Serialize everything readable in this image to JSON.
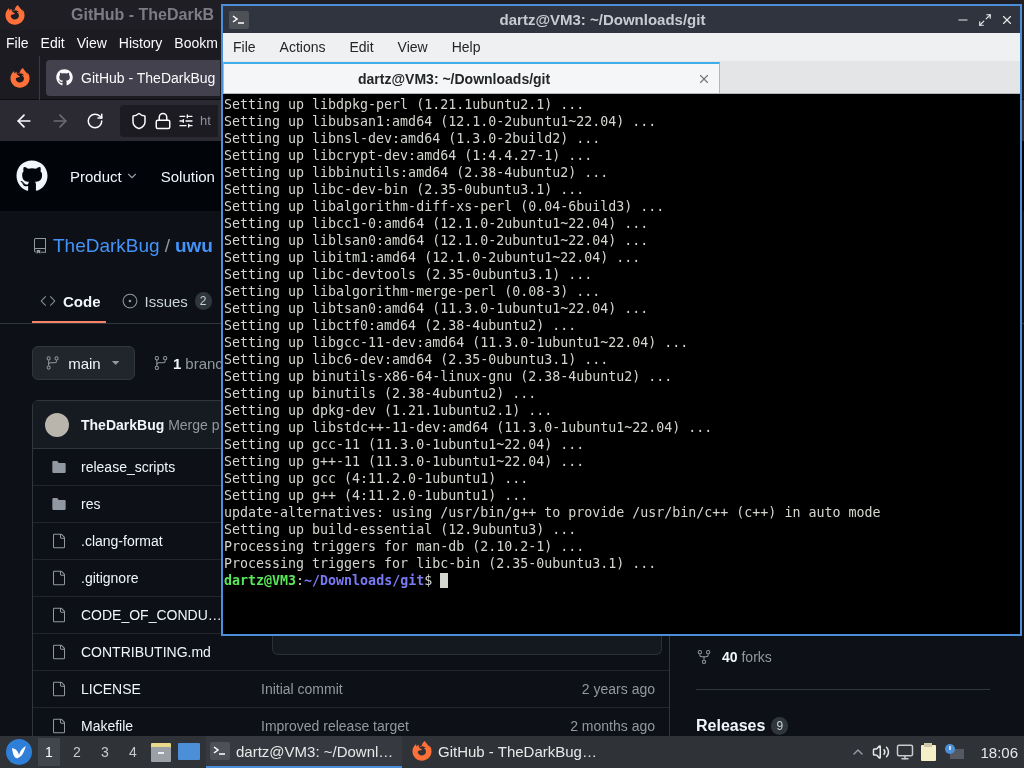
{
  "browser": {
    "window_title": "GitHub - TheDarkB",
    "menu": [
      "File",
      "Edit",
      "View",
      "History",
      "Bookm"
    ],
    "tab": {
      "title": "GitHub - TheDarkBug"
    },
    "nav_buttons": [
      {
        "kind": "back",
        "disabled": false
      },
      {
        "kind": "forward",
        "disabled": true
      },
      {
        "kind": "reload",
        "disabled": false
      }
    ],
    "url_prefix": "ht",
    "github": {
      "nav": [
        {
          "label": "Product",
          "dropdown": true
        },
        {
          "label": "Solution",
          "dropdown": false
        }
      ],
      "owner": "TheDarkBug",
      "separator": "/",
      "repo": "uwu",
      "repo_tabs": [
        {
          "kind": "code",
          "label": "Code",
          "selected": true
        },
        {
          "kind": "issues",
          "label": "Issues",
          "count": "2",
          "selected": false
        }
      ],
      "branch": "main",
      "branches_count": "1",
      "branches_label": "branc",
      "latest_commit": {
        "author": "TheDarkBug",
        "message": "Merge p"
      },
      "files": [
        {
          "kind": "folder",
          "name": "release_scripts"
        },
        {
          "kind": "folder",
          "name": "res"
        },
        {
          "kind": "file",
          "name": ".clang-format"
        },
        {
          "kind": "file",
          "name": ".gitignore"
        },
        {
          "kind": "file",
          "name": "CODE_OF_CONDU…"
        },
        {
          "kind": "file",
          "name": "CONTRIBUTING.md"
        },
        {
          "kind": "file",
          "name": "LICENSE",
          "message": "Initial commit",
          "time": "2 years ago"
        },
        {
          "kind": "file",
          "name": "Makefile",
          "message": "Improved release target",
          "time": "2 months ago"
        }
      ],
      "sidebar": {
        "forks_count": "40",
        "forks_label": "forks",
        "releases_label": "Releases",
        "releases_count": "9"
      }
    }
  },
  "terminal": {
    "title": "dartz@VM3: ~/Downloads/git",
    "menu": [
      "File",
      "Actions",
      "Edit",
      "View",
      "Help"
    ],
    "tab": {
      "title": "dartz@VM3: ~/Downloads/git"
    },
    "lines": [
      "Setting up libdpkg-perl (1.21.1ubuntu2.1) ...",
      "Setting up libubsan1:amd64 (12.1.0-2ubuntu1~22.04) ...",
      "Setting up libnsl-dev:amd64 (1.3.0-2build2) ...",
      "Setting up libcrypt-dev:amd64 (1:4.4.27-1) ...",
      "Setting up libbinutils:amd64 (2.38-4ubuntu2) ...",
      "Setting up libc-dev-bin (2.35-0ubuntu3.1) ...",
      "Setting up libalgorithm-diff-xs-perl (0.04-6build3) ...",
      "Setting up libcc1-0:amd64 (12.1.0-2ubuntu1~22.04) ...",
      "Setting up liblsan0:amd64 (12.1.0-2ubuntu1~22.04) ...",
      "Setting up libitm1:amd64 (12.1.0-2ubuntu1~22.04) ...",
      "Setting up libc-devtools (2.35-0ubuntu3.1) ...",
      "Setting up libalgorithm-merge-perl (0.08-3) ...",
      "Setting up libtsan0:amd64 (11.3.0-1ubuntu1~22.04) ...",
      "Setting up libctf0:amd64 (2.38-4ubuntu2) ...",
      "Setting up libgcc-11-dev:amd64 (11.3.0-1ubuntu1~22.04) ...",
      "Setting up libc6-dev:amd64 (2.35-0ubuntu3.1) ...",
      "Setting up binutils-x86-64-linux-gnu (2.38-4ubuntu2) ...",
      "Setting up binutils (2.38-4ubuntu2) ...",
      "Setting up dpkg-dev (1.21.1ubuntu2.1) ...",
      "Setting up libstdc++-11-dev:amd64 (11.3.0-1ubuntu1~22.04) ...",
      "Setting up gcc-11 (11.3.0-1ubuntu1~22.04) ...",
      "Setting up g++-11 (11.3.0-1ubuntu1~22.04) ...",
      "Setting up gcc (4:11.2.0-1ubuntu1) ...",
      "Setting up g++ (4:11.2.0-1ubuntu1) ...",
      "update-alternatives: using /usr/bin/g++ to provide /usr/bin/c++ (c++) in auto mode",
      "Setting up build-essential (12.9ubuntu3) ...",
      "Processing triggers for man-db (2.10.2-1) ...",
      "Processing triggers for libc-bin (2.35-0ubuntu3.1) ..."
    ],
    "prompt": {
      "user": "dartz@VM3",
      "separator": ":",
      "path": "~/Downloads/git",
      "symbol": "$"
    }
  },
  "taskbar": {
    "workspaces": [
      {
        "label": "1",
        "selected": true
      },
      {
        "label": "2",
        "selected": false
      },
      {
        "label": "3",
        "selected": false
      },
      {
        "label": "4",
        "selected": false
      }
    ],
    "tasks": [
      {
        "kind": "terminal",
        "title": "dartz@VM3: ~/Downl…",
        "selected": true
      },
      {
        "kind": "firefox",
        "title": "GitHub - TheDarkBug…",
        "selected": false
      }
    ],
    "clock": "18:06"
  }
}
